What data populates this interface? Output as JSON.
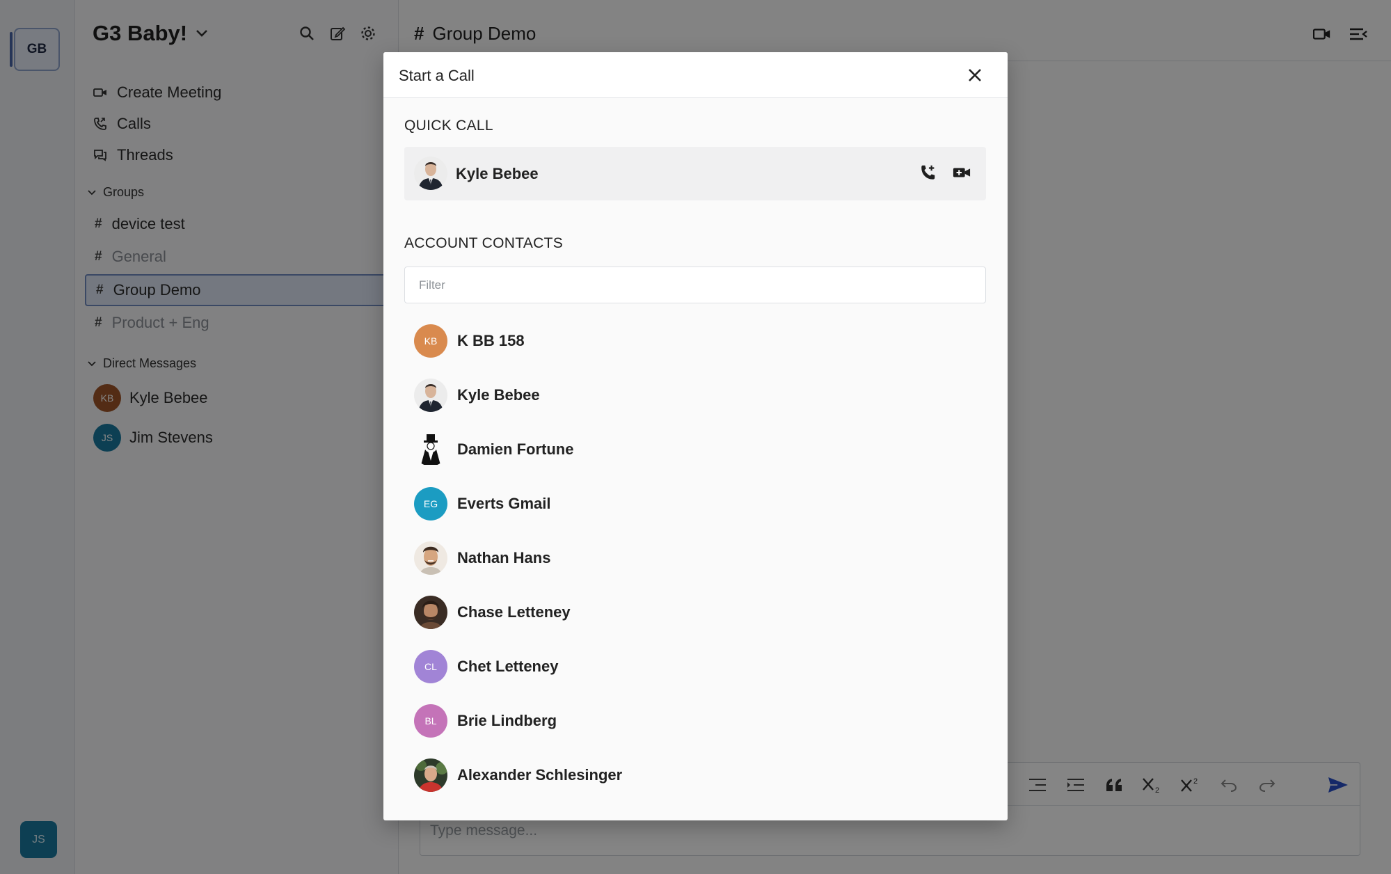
{
  "workspace": {
    "initials": "GB",
    "name": "G3 Baby!"
  },
  "current_user": {
    "initials": "JS"
  },
  "sidebar": {
    "nav": [
      {
        "label": "Create Meeting",
        "icon": "video-icon"
      },
      {
        "label": "Calls",
        "icon": "phone-icon"
      },
      {
        "label": "Threads",
        "icon": "threads-icon"
      }
    ],
    "groups_label": "Groups",
    "groups": [
      {
        "label": "device test",
        "muted": false
      },
      {
        "label": "General",
        "muted": true
      },
      {
        "label": "Group Demo",
        "muted": false,
        "active": true
      },
      {
        "label": "Product + Eng",
        "muted": true
      }
    ],
    "dm_label": "Direct Messages",
    "dms": [
      {
        "label": "Kyle Bebee",
        "initials": "KB",
        "color": "#a0552a"
      },
      {
        "label": "Jim Stevens",
        "initials": "JS",
        "color": "#1a7aa0"
      }
    ]
  },
  "main": {
    "channel_title": "Group Demo",
    "composer_placeholder": "Type message..."
  },
  "modal": {
    "title": "Start a Call",
    "quick_call_label": "QUICK CALL",
    "quick_call_contact": "Kyle Bebee",
    "contacts_label": "ACCOUNT CONTACTS",
    "filter_placeholder": "Filter",
    "contacts": [
      {
        "name": "K BB 158",
        "initials": "KB",
        "color": "#d98a4e",
        "photo": false
      },
      {
        "name": "Kyle Bebee",
        "initials": "",
        "color": "",
        "photo": true
      },
      {
        "name": "Damien Fortune",
        "initials": "",
        "color": "",
        "photo": true
      },
      {
        "name": "Everts Gmail",
        "initials": "EG",
        "color": "#1b9cc2",
        "photo": false
      },
      {
        "name": "Nathan Hans",
        "initials": "",
        "color": "",
        "photo": true
      },
      {
        "name": "Chase Letteney",
        "initials": "",
        "color": "",
        "photo": true
      },
      {
        "name": "Chet Letteney",
        "initials": "CL",
        "color": "#a184d6",
        "photo": false
      },
      {
        "name": "Brie Lindberg",
        "initials": "BL",
        "color": "#c473b8",
        "photo": false
      },
      {
        "name": "Alexander Schlesinger",
        "initials": "",
        "color": "",
        "photo": true
      }
    ]
  },
  "colors": {
    "accent": "#2950c7",
    "active_channel_bg": "#dfe7f5"
  }
}
